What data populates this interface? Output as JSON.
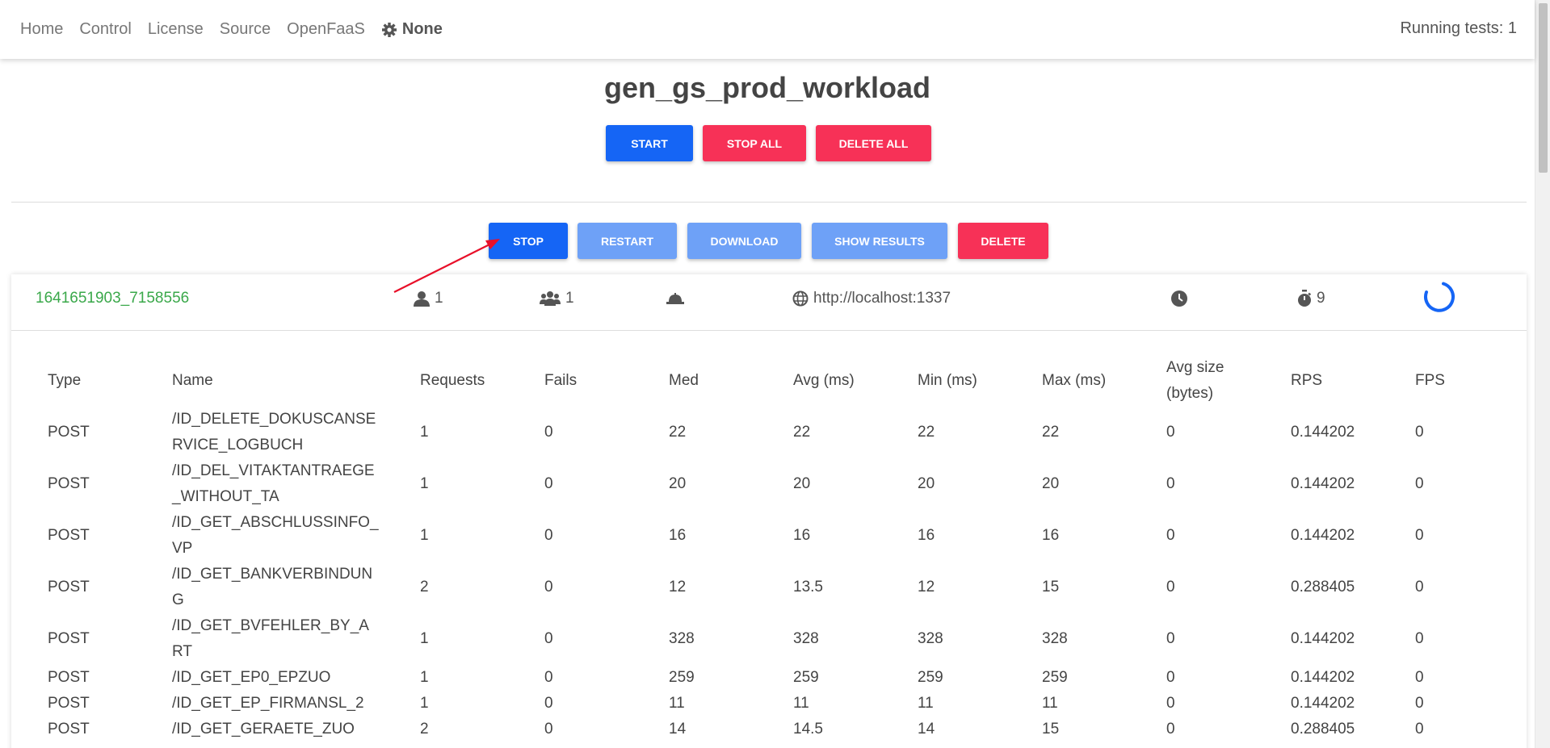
{
  "nav": {
    "links": [
      "Home",
      "Control",
      "License",
      "Source",
      "OpenFaaS"
    ],
    "settings_label": "None",
    "running_tests": "Running tests: 1"
  },
  "page_title": "gen_gs_prod_workload",
  "top_actions": {
    "start": "START",
    "stop_all": "STOP ALL",
    "delete_all": "DELETE ALL"
  },
  "test_actions": {
    "stop": "STOP",
    "restart": "RESTART",
    "download": "DOWNLOAD",
    "show_results": "SHOW RESULTS",
    "delete": "DELETE"
  },
  "test": {
    "id": "1641651903_7158556",
    "users": "1",
    "spawn_rate": "1",
    "host": "http://localhost:1337",
    "time_limit": "",
    "runtime": "9"
  },
  "table": {
    "headers": [
      "Type",
      "Name",
      "Requests",
      "Fails",
      "Med",
      "Avg (ms)",
      "Min (ms)",
      "Max (ms)",
      "Avg size (bytes)",
      "RPS",
      "FPS"
    ],
    "rows": [
      [
        "POST",
        "/ID_DELETE_DOKUSCANSERVICE_LOGBUCH",
        "1",
        "0",
        "22",
        "22",
        "22",
        "22",
        "0",
        "0.144202",
        "0"
      ],
      [
        "POST",
        "/ID_DEL_VITAKTANTRAEGE_WITHOUT_TA",
        "1",
        "0",
        "20",
        "20",
        "20",
        "20",
        "0",
        "0.144202",
        "0"
      ],
      [
        "POST",
        "/ID_GET_ABSCHLUSSINFO_VP",
        "1",
        "0",
        "16",
        "16",
        "16",
        "16",
        "0",
        "0.144202",
        "0"
      ],
      [
        "POST",
        "/ID_GET_BANKVERBINDUNG",
        "2",
        "0",
        "12",
        "13.5",
        "12",
        "15",
        "0",
        "0.288405",
        "0"
      ],
      [
        "POST",
        "/ID_GET_BVFEHLER_BY_ART",
        "1",
        "0",
        "328",
        "328",
        "328",
        "328",
        "0",
        "0.144202",
        "0"
      ],
      [
        "POST",
        "/ID_GET_EP0_EPZUO",
        "1",
        "0",
        "259",
        "259",
        "259",
        "259",
        "0",
        "0.144202",
        "0"
      ],
      [
        "POST",
        "/ID_GET_EP_FIRMANSL_2",
        "1",
        "0",
        "11",
        "11",
        "11",
        "11",
        "0",
        "0.144202",
        "0"
      ],
      [
        "POST",
        "/ID_GET_GERAETE_ZUO",
        "2",
        "0",
        "14",
        "14.5",
        "14",
        "15",
        "0",
        "0.288405",
        "0"
      ]
    ]
  },
  "colors": {
    "primary": "#1565f5",
    "danger": "#f73157",
    "primary_light": "#6ea1f7",
    "success": "#3aa84a",
    "annotation": "#e8102a"
  },
  "icons": [
    "gear-icon",
    "user-icon",
    "users-icon",
    "hat-icon",
    "globe-icon",
    "clock-icon",
    "stopwatch-icon",
    "loading-spinner-icon"
  ]
}
